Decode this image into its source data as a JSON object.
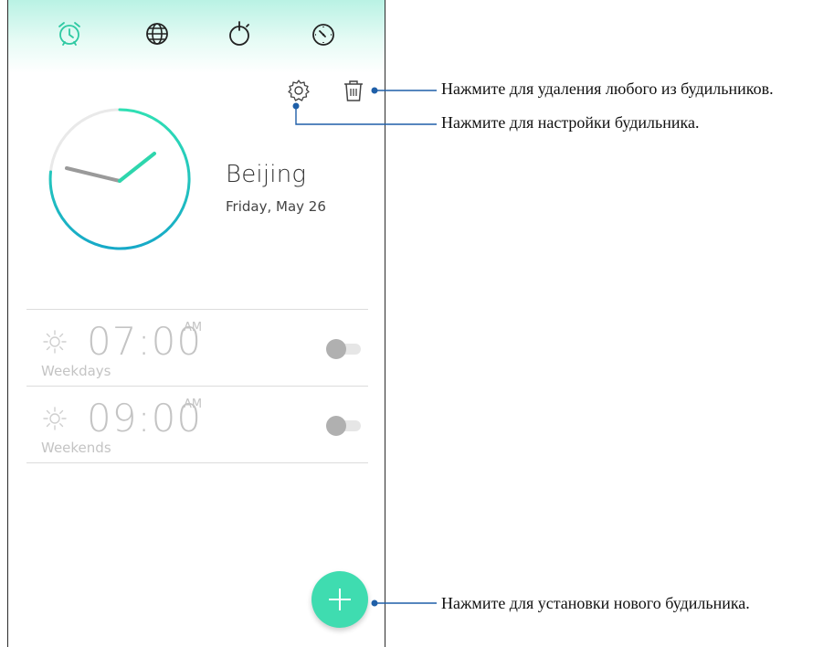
{
  "tabs": [
    {
      "icon": "alarm-clock-icon",
      "label": "Alarm",
      "active": true
    },
    {
      "icon": "globe-icon",
      "label": "World clock",
      "active": false
    },
    {
      "icon": "stopwatch-icon",
      "label": "Stopwatch",
      "active": false
    },
    {
      "icon": "timer-icon",
      "label": "Timer",
      "active": false
    }
  ],
  "toolbar": {
    "settings_icon": "gear-icon",
    "delete_icon": "trash-icon"
  },
  "world_clock": {
    "city": "Beijing",
    "date": "Friday, May 26"
  },
  "alarms": [
    {
      "time": "07:00",
      "ampm": "AM",
      "repeat": "Weekdays",
      "enabled": false,
      "icon": "sun-icon"
    },
    {
      "time": "09:00",
      "ampm": "AM",
      "repeat": "Weekends",
      "enabled": false,
      "icon": "sun-icon"
    }
  ],
  "fab": {
    "icon": "plus-icon"
  },
  "callouts": {
    "delete": "Нажмите для удаления любого из будильников.",
    "settings": "Нажмите для настройки будильника.",
    "add": "Нажмите для установки нового будильника."
  },
  "colors": {
    "accent": "#3fdcb0",
    "callout_line": "#1f5fa8",
    "inactive": "#c4c4c4"
  }
}
